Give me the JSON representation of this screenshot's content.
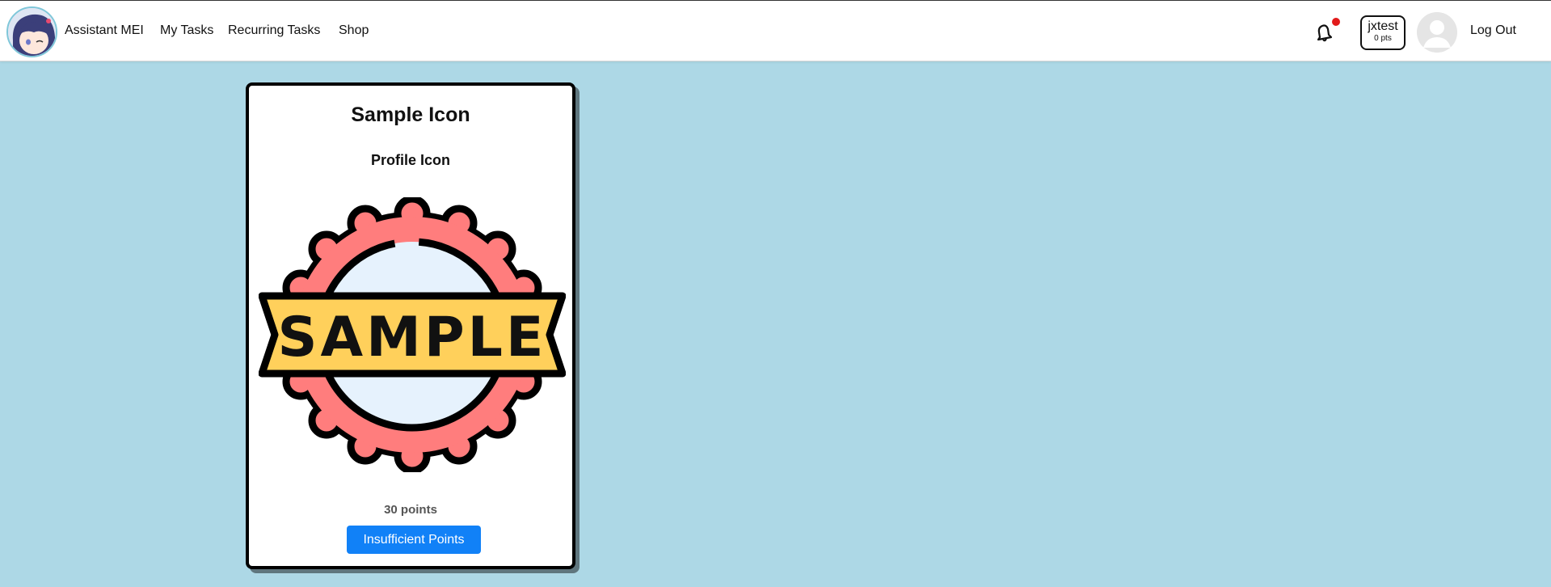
{
  "nav": {
    "brand_name": "Assistant MEI",
    "links": [
      "My Tasks",
      "Recurring Tasks",
      "Shop"
    ],
    "notification_icon": "bell-icon",
    "user": {
      "name": "jxtest",
      "points": "0 pts"
    },
    "logout_label": "Log Out"
  },
  "card": {
    "title": "Sample Icon",
    "subtitle": "Profile Icon",
    "image_text": "SAMPLE",
    "points": "30 points",
    "button_label": "Insufficient Points"
  },
  "colors": {
    "page_bg": "#add8e6",
    "button": "#1181f7",
    "badge_red": "#ff7d7d",
    "ribbon_yellow": "#ffd05b"
  }
}
